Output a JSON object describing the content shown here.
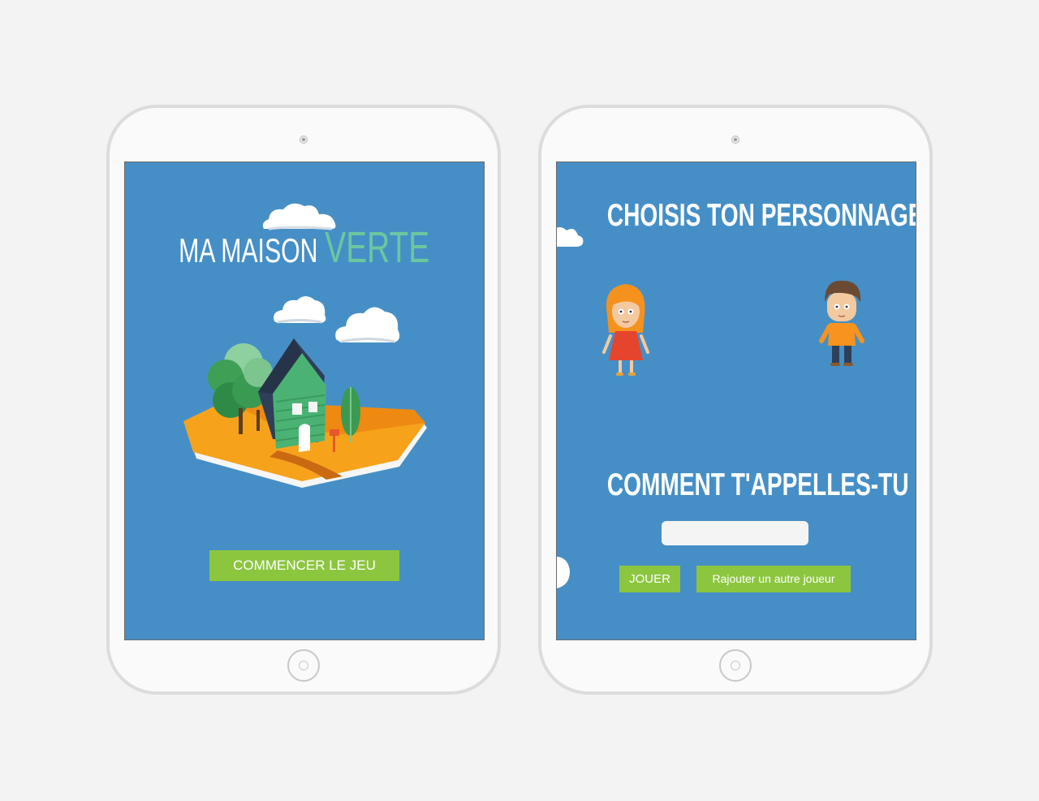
{
  "start_screen": {
    "logo": {
      "part1": "MA MAISON",
      "part2": "VERTE"
    },
    "start_button": "COMMENCER LE JEU"
  },
  "player_screen": {
    "choose_heading": "CHOISIS TON PERSONNAGE",
    "name_heading": "COMMENT T'APPELLES-TU ?",
    "name_input": {
      "value": "",
      "placeholder": ""
    },
    "play_button": "JOUER",
    "add_player_button": "Rajouter un autre joueur"
  },
  "colors": {
    "screen_background": "#468fc6",
    "button": "#8cc63f",
    "logo_accent": "#6cc6a0"
  },
  "icons": [
    "cloud-icon",
    "house-illustration",
    "girl-character",
    "boy-character"
  ]
}
